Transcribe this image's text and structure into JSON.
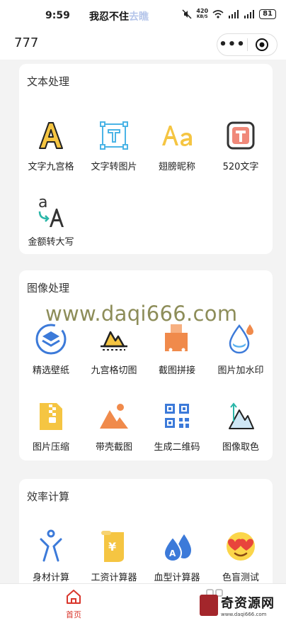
{
  "status_bar": {
    "time": "9:59",
    "notification": "我忍不住",
    "notification_tail": "去瞧",
    "network_speed_value": "420",
    "network_speed_unit": "KB/S",
    "battery": "81"
  },
  "nav": {
    "title": "777",
    "more_label": "•••"
  },
  "sections": [
    {
      "title": "文本处理",
      "tools": [
        {
          "label": "文字九宫格",
          "icon": "letter-a-icon"
        },
        {
          "label": "文字转图片",
          "icon": "text-frame-icon"
        },
        {
          "label": "翅膀昵称",
          "icon": "font-aa-icon"
        },
        {
          "label": "520文字",
          "icon": "t-square-icon"
        },
        {
          "label": "金额转大写",
          "icon": "case-convert-icon"
        }
      ]
    },
    {
      "title": "图像处理",
      "tools": [
        {
          "label": "精选壁纸",
          "icon": "layers-icon"
        },
        {
          "label": "九宫格切图",
          "icon": "crop-mountain-icon"
        },
        {
          "label": "截图拼接",
          "icon": "puzzle-icon"
        },
        {
          "label": "图片加水印",
          "icon": "watermark-drop-icon"
        },
        {
          "label": "图片压缩",
          "icon": "zip-file-icon"
        },
        {
          "label": "带壳截图",
          "icon": "mountain-image-icon"
        },
        {
          "label": "生成二维码",
          "icon": "qr-code-icon"
        },
        {
          "label": "图像取色",
          "icon": "color-picker-icon"
        }
      ]
    },
    {
      "title": "效率计算",
      "tools": [
        {
          "label": "身材计算",
          "icon": "body-figure-icon"
        },
        {
          "label": "工资计算器",
          "icon": "salary-scroll-icon"
        },
        {
          "label": "血型计算器",
          "icon": "blood-drop-icon"
        },
        {
          "label": "色盲测试",
          "icon": "heart-glasses-emoji-icon"
        }
      ]
    }
  ],
  "watermark": "www.daqi666.com",
  "tab_bar": {
    "home_label": "首页",
    "brand_name": "奇资源网",
    "brand_url": "www.daqi666.com"
  },
  "colors": {
    "accent_red": "#d9352b",
    "icon_yellow": "#f5c542",
    "icon_blue": "#3c7ad9",
    "icon_orange": "#f08a4b"
  }
}
